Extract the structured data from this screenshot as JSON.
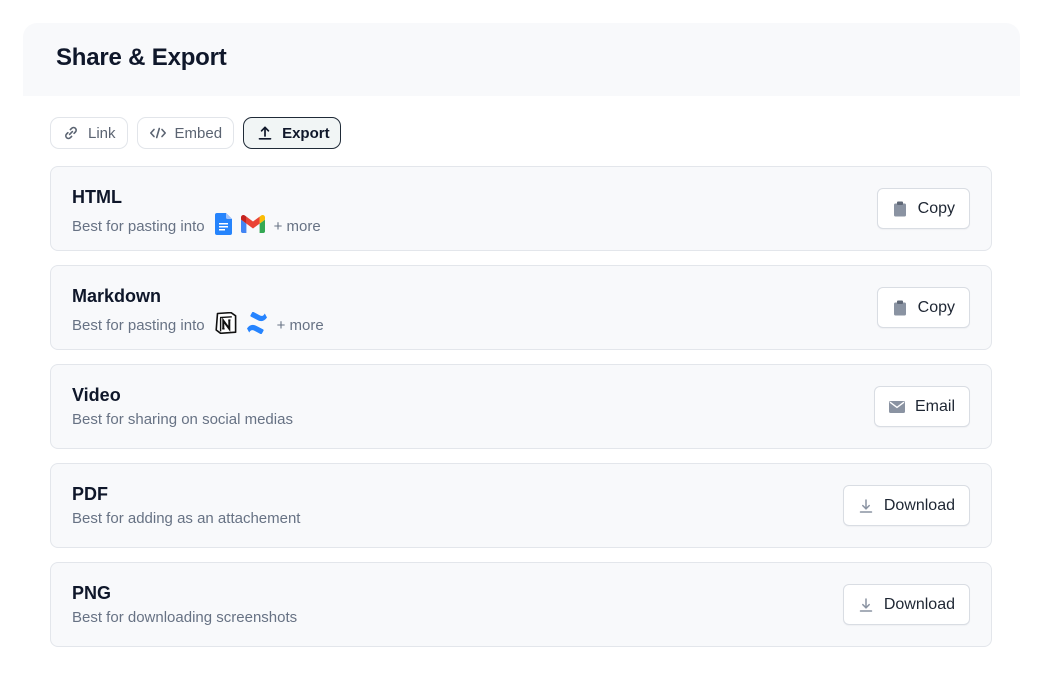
{
  "panel": {
    "title": "Share & Export"
  },
  "tabs": [
    {
      "label": "Link",
      "icon": "link-icon",
      "active": false
    },
    {
      "label": "Embed",
      "icon": "code-icon",
      "active": false
    },
    {
      "label": "Export",
      "icon": "upload-icon",
      "active": true
    }
  ],
  "cards": [
    {
      "title": "HTML",
      "description": "Best for pasting into",
      "apps": [
        "google-docs-icon",
        "gmail-icon"
      ],
      "more": "+ more",
      "button": {
        "label": "Copy",
        "icon": "clipboard-icon"
      }
    },
    {
      "title": "Markdown",
      "description": "Best for pasting into",
      "apps": [
        "notion-icon",
        "confluence-icon"
      ],
      "more": "+ more",
      "button": {
        "label": "Copy",
        "icon": "clipboard-icon"
      }
    },
    {
      "title": "Video",
      "description": "Best for sharing on social medias",
      "button": {
        "label": "Email",
        "icon": "mail-icon"
      }
    },
    {
      "title": "PDF",
      "description": "Best for adding as an attachement",
      "button": {
        "label": "Download",
        "icon": "download-icon"
      }
    },
    {
      "title": "PNG",
      "description": "Best for downloading screenshots",
      "button": {
        "label": "Download",
        "icon": "download-icon"
      }
    }
  ],
  "colors": {
    "accent": "#1f2a37",
    "muted_text": "#677284",
    "card_bg": "#f8f9fb",
    "google_docs_blue": "#2684fc",
    "gmail_red": "#ea4335",
    "confluence_blue": "#2684ff"
  }
}
